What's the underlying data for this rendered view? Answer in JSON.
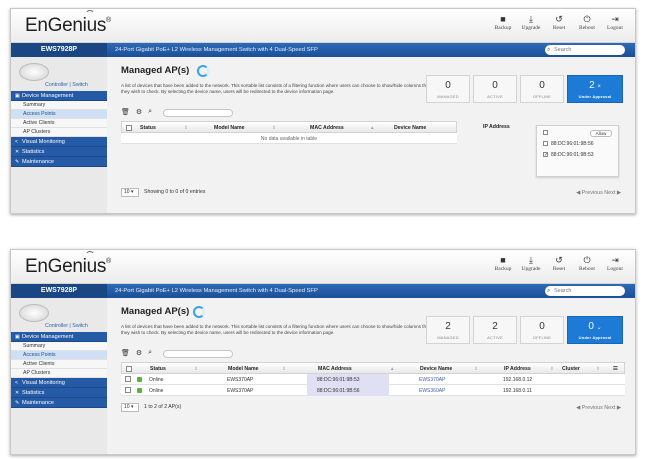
{
  "topbar": {
    "logo": "EnGenius",
    "tools": [
      {
        "icon": "backup-icon",
        "glyph": "■",
        "label": "Backup"
      },
      {
        "icon": "upgrade-icon",
        "glyph": "⤓",
        "label": "Upgrade"
      },
      {
        "icon": "reset-icon",
        "glyph": "↺",
        "label": "Reset"
      },
      {
        "icon": "reboot-icon",
        "glyph": "⏻",
        "label": "Reboot"
      },
      {
        "icon": "logout-icon",
        "glyph": "⇥",
        "label": "Logout"
      }
    ]
  },
  "bluebar": {
    "model": "EWS7928P",
    "description": "24-Port Gigabit PoE+ L2 Wireless Management Switch with 4 Dual-Speed SFP",
    "search_placeholder": "Search"
  },
  "sidebar": {
    "controller_link": "Controller | Switch",
    "device_management": "Device Management",
    "sub_items": [
      "Summary",
      "Access Points",
      "Active Clients",
      "AP Clusters"
    ],
    "visual_monitoring": "Visual Monitoring",
    "statistics": "Statistics",
    "maintenance": "Maintenance"
  },
  "page": {
    "title": "Managed AP(s)",
    "description": "A list of devices that have been added to the network. This sortable list consists of a filtering function where users can choose to show/hide columns that they wish to check. By selecting the device name, users will be redirected to the device information page."
  },
  "screen1": {
    "stats": [
      {
        "value": "0",
        "caption": "MANAGED"
      },
      {
        "value": "0",
        "caption": "ACTIVE"
      },
      {
        "value": "0",
        "caption": "OFFLINE"
      },
      {
        "value": "2",
        "caption": "Under Approval",
        "icon": "close-icon"
      }
    ],
    "columns": [
      "Status",
      "Model Name",
      "MAC Address",
      "Device Name",
      "IP Address"
    ],
    "no_data": "No data available in table",
    "page_size": "10",
    "entries": "Showing 0 to 0 of 0 entries",
    "pagination": "◀ Previous  Next ▶",
    "popup": {
      "filter_label": "Allow",
      "items": [
        {
          "label": "88:DC:96:01:9B:56",
          "checked": false
        },
        {
          "label": "88:DC:96:01:9B:53",
          "checked": true
        }
      ]
    }
  },
  "screen2": {
    "stats": [
      {
        "value": "2",
        "caption": "MANAGED"
      },
      {
        "value": "2",
        "caption": "ACTIVE"
      },
      {
        "value": "0",
        "caption": "OFFLINE"
      },
      {
        "value": "0",
        "caption": "Under Approval",
        "icon": "chevron-down-icon"
      }
    ],
    "columns": [
      "Status",
      "Model Name",
      "MAC Address",
      "Device Name",
      "IP Address",
      "Cluster"
    ],
    "rows": [
      {
        "status": "Online",
        "model": "EWS370AP",
        "mac": "88:DC:96:01:9B:53",
        "device": "EWS370AP",
        "ip": "192.168.0.12"
      },
      {
        "status": "Online",
        "model": "EWS370AP",
        "mac": "88:DC:96:01:9B:56",
        "device": "EWS360AP",
        "ip": "192.168.0.11"
      }
    ],
    "page_size": "10",
    "entries": "1 to 2 of 2 AP(s)",
    "pagination": "◀ Previous  Next ▶"
  },
  "colors": {
    "nav_blue": "#245aa6",
    "accent_blue": "#1d7ad6",
    "online_green": "#58b43b"
  }
}
